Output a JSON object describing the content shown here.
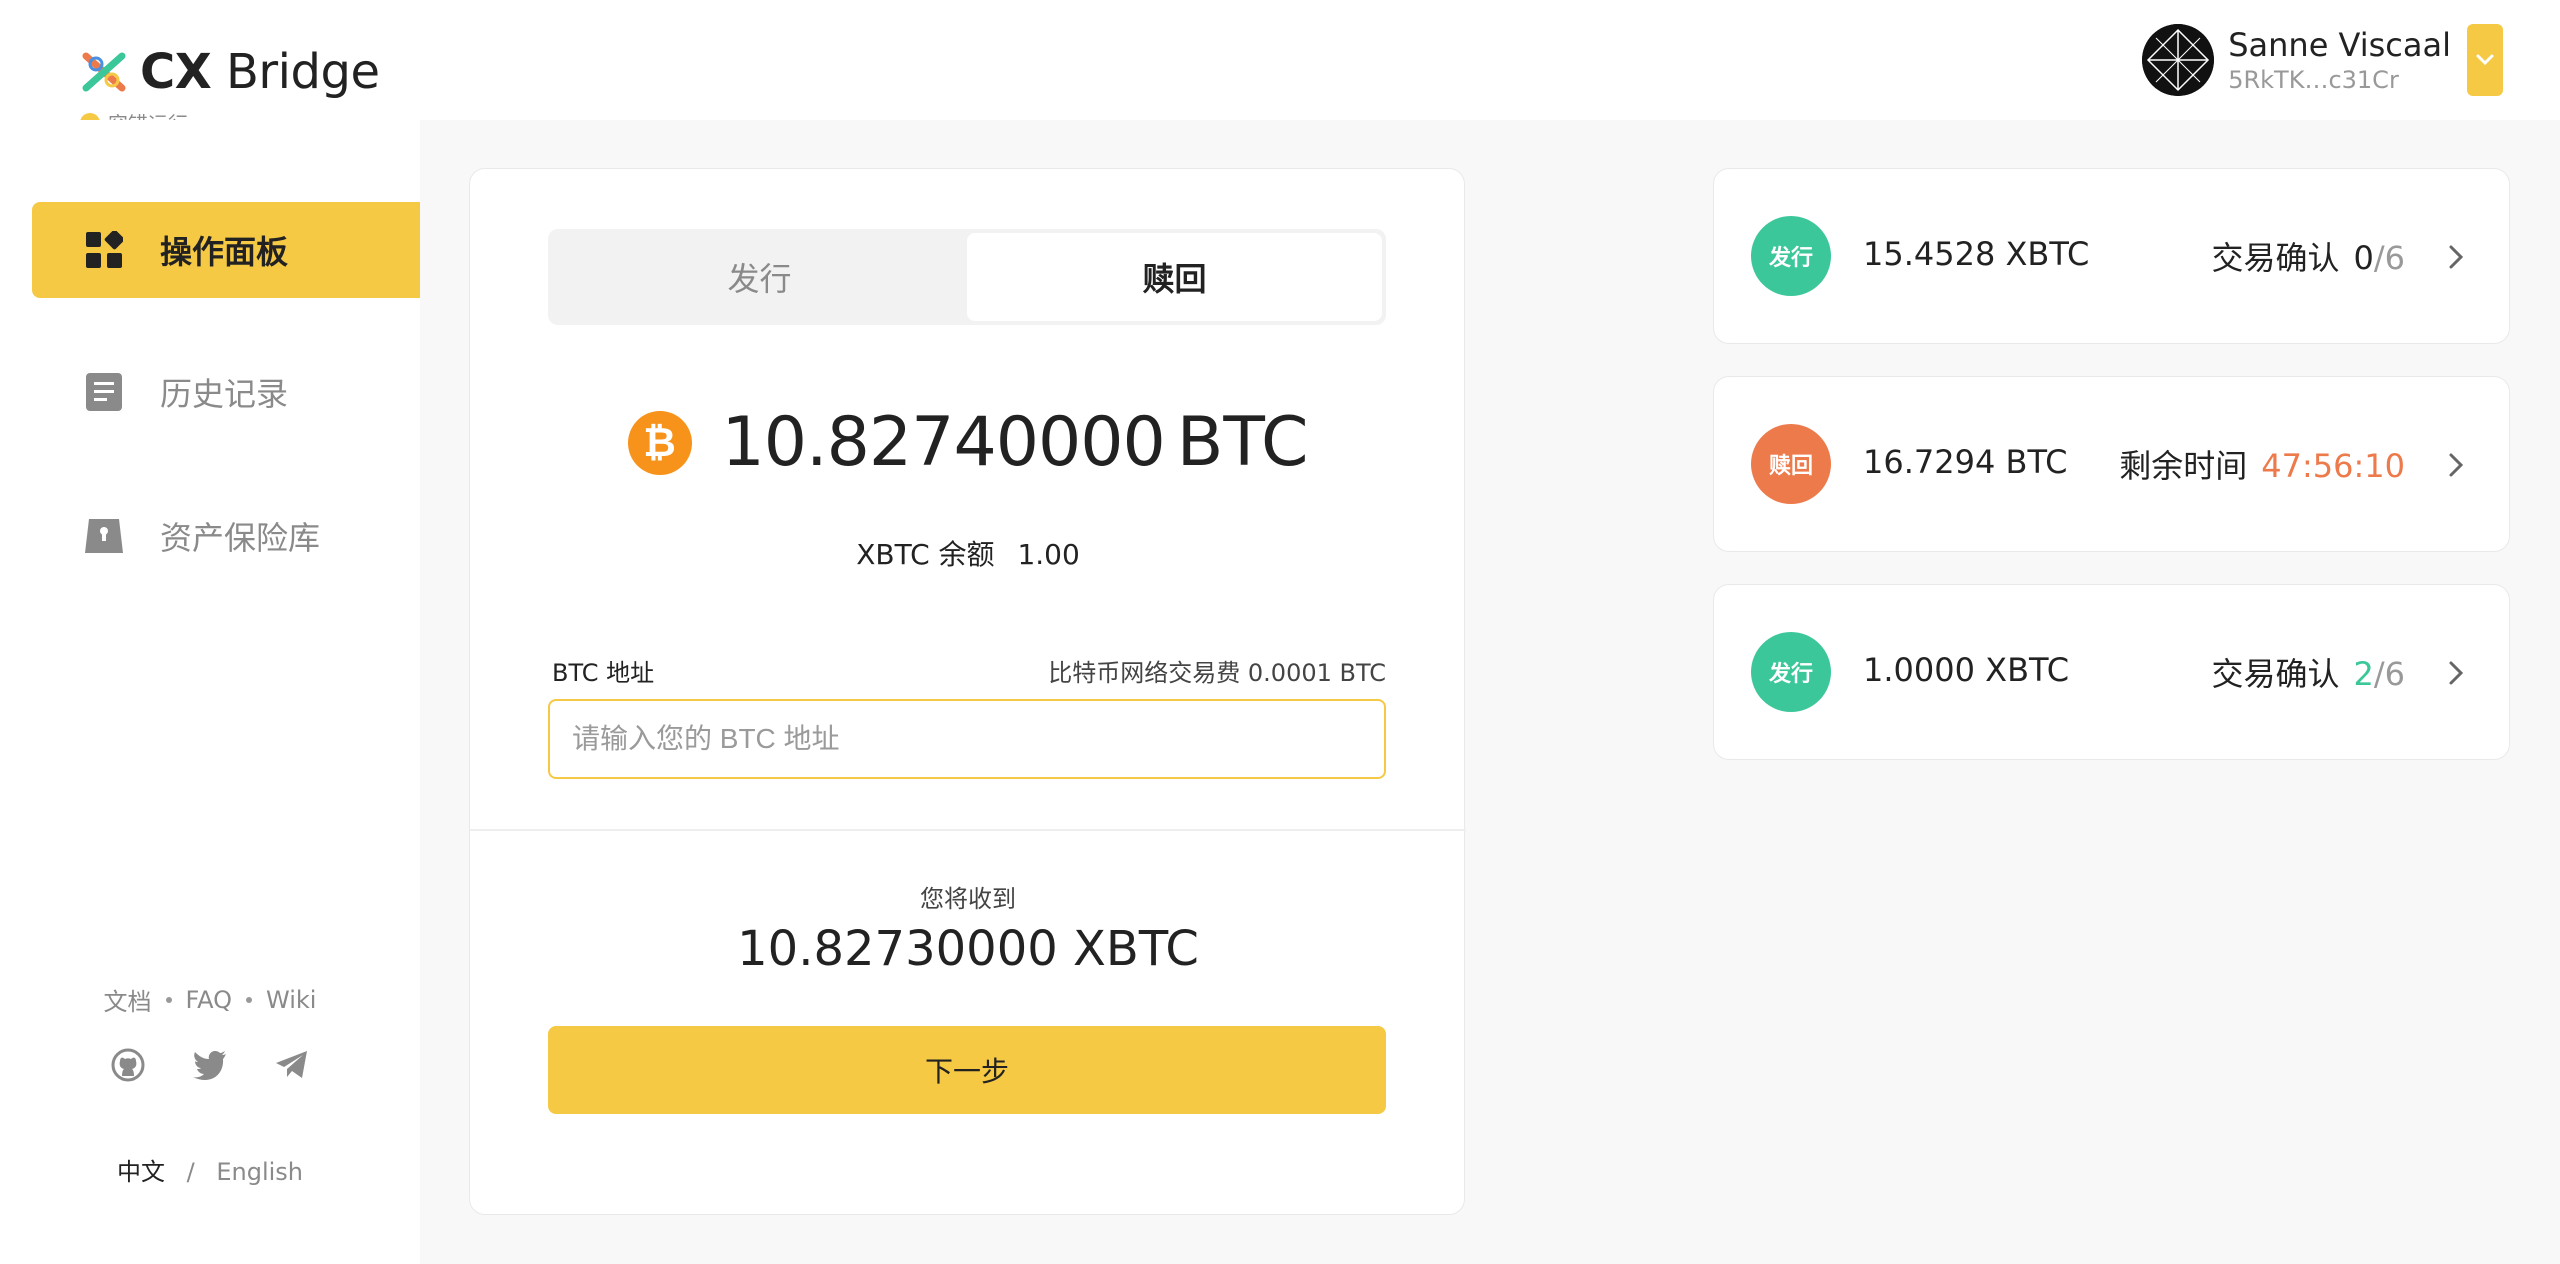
{
  "app": {
    "logo_bold": "CX",
    "logo_light": "Bridge",
    "status_text": "容错运行"
  },
  "user": {
    "name": "Sanne Viscaal",
    "address": "5RkTK…c31Cr"
  },
  "sidebar": {
    "items": [
      {
        "label": "操作面板",
        "icon": "dashboard-icon"
      },
      {
        "label": "历史记录",
        "icon": "history-icon"
      },
      {
        "label": "资产保险库",
        "icon": "vault-icon"
      }
    ],
    "links": [
      "文档",
      "FAQ",
      "Wiki"
    ],
    "lang_current": "中文",
    "lang_sep": "/",
    "lang_other": "English"
  },
  "main": {
    "tabs": [
      "发行",
      "赎回"
    ],
    "active_tab": "赎回",
    "balance_value": "10.82740000",
    "balance_unit": "BTC",
    "xbtc_balance_label": "XBTC 余额",
    "xbtc_balance_value": "1.00",
    "address_label": "BTC 地址",
    "fee_label": "比特币网络交易费 0.0001 BTC",
    "address_placeholder": "请输入您的 BTC 地址",
    "receive_label": "您将收到",
    "receive_amount": "10.82730000 XBTC",
    "next_button": "下一步"
  },
  "transactions": [
    {
      "type": "发行",
      "color": "#3cc79a",
      "amount": "15.4528 XBTC",
      "meta_label": "交易确认",
      "current": "0",
      "total": "/6",
      "current_color": "#222222"
    },
    {
      "type": "赎回",
      "color": "#ed7a4b",
      "amount": "16.7294 BTC",
      "meta_label": "剩余时间",
      "current": "47:56:10",
      "total": "",
      "current_color": "#ed7a4b"
    },
    {
      "type": "发行",
      "color": "#3cc79a",
      "amount": "1.0000 XBTC",
      "meta_label": "交易确认",
      "current": "2",
      "total": "/6",
      "current_color": "#3cc79a"
    }
  ],
  "colors": {
    "accent": "#f6c944",
    "issue": "#3cc79a",
    "redeem": "#ed7a4b"
  }
}
